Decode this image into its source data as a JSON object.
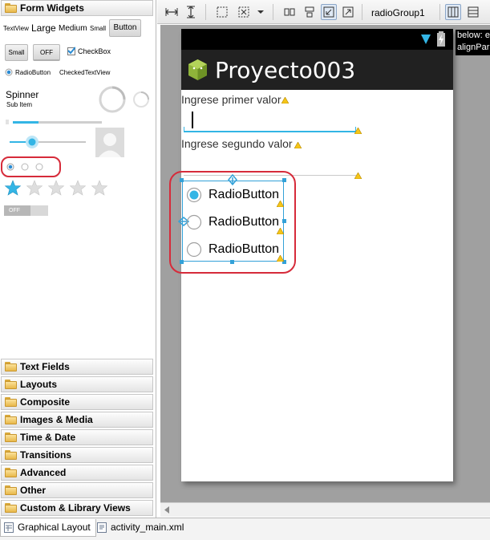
{
  "palette": {
    "form_widgets": "Form Widgets",
    "textview": "TextView",
    "large": "Large",
    "medium": "Medium",
    "small": "Small",
    "button": "Button",
    "small_button": "Small",
    "toggle_off": "OFF",
    "checkbox": "CheckBox",
    "radiobutton": "RadioButton",
    "checkedtextview": "CheckedTextView",
    "spinner": "Spinner",
    "sub_item": "Sub Item",
    "switch_off": "OFF",
    "categories": [
      "Text Fields",
      "Layouts",
      "Composite",
      "Images & Media",
      "Time & Date",
      "Transitions",
      "Advanced",
      "Other",
      "Custom & Library Views"
    ]
  },
  "toolbar": {
    "selected_component": "radioGroup1"
  },
  "tooltip": {
    "line1": "below: e",
    "line2": "alignPar"
  },
  "phone": {
    "app_title": "Proyecto003",
    "label1": "Ingrese primer valor",
    "label2": "Ingrese segundo valor",
    "radios": [
      {
        "label": "RadioButton",
        "checked": true
      },
      {
        "label": "RadioButton",
        "checked": false
      },
      {
        "label": "RadioButton",
        "checked": false
      }
    ]
  },
  "tabs": {
    "graphical_layout": "Graphical Layout",
    "activity_main": "activity_main.xml"
  },
  "colors": {
    "accent": "#33b5e5",
    "highlight": "#d62b3a",
    "action_bar": "#212121",
    "android_green": "#a4c639"
  }
}
